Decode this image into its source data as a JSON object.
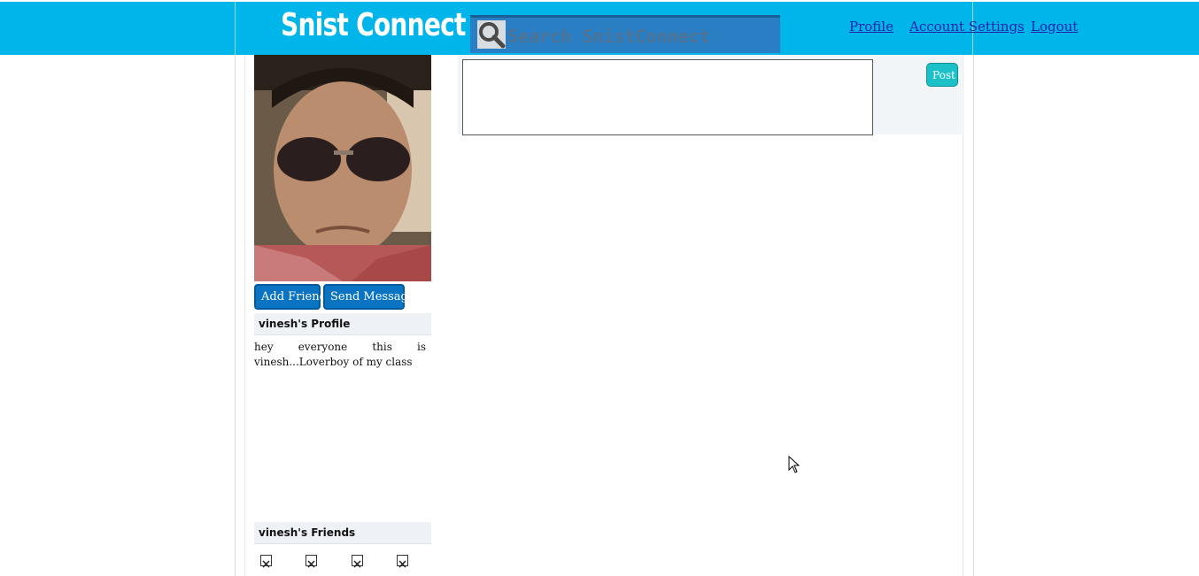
{
  "header": {
    "logo": "Snist Connect",
    "search_placeholder": "Search SnistConnect",
    "nav": {
      "profile": "Profile",
      "account_settings": "Account Settings",
      "logout": "Logout"
    },
    "colors": {
      "bar": "#00b5e9",
      "search_bg": "#2a7ec3"
    }
  },
  "sidebar": {
    "add_friend": "Add Friend",
    "send_message": "Send Message",
    "profile_heading": "vinesh's Profile",
    "bio": "hey everyone this is vinesh...Loverboy of my class",
    "friends_heading": "vinesh's Friends",
    "friend_icon": "broken-image-icon"
  },
  "main": {
    "post_button": "Post",
    "post_text": ""
  }
}
